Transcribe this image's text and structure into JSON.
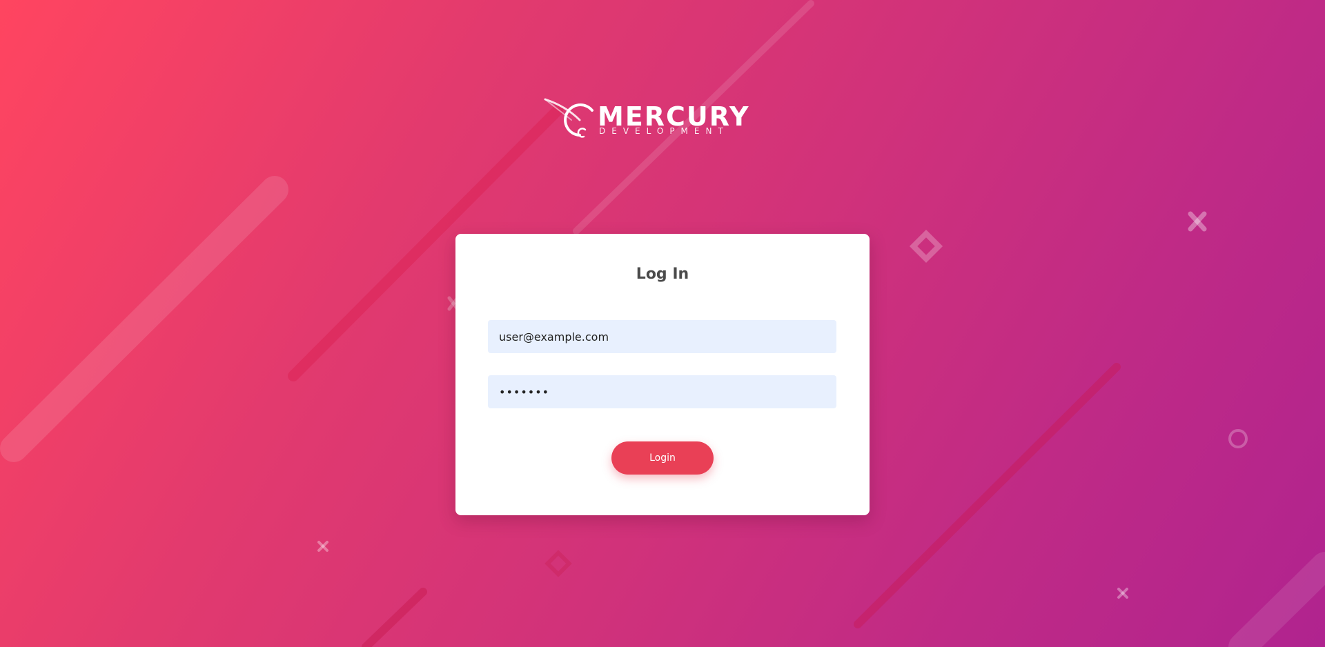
{
  "brand": {
    "name": "MERCURY",
    "tagline": "DEVELOPMENT",
    "logo_icon": "mercury-orbit-icon"
  },
  "login_form": {
    "title": "Log In",
    "email_value": "user@example.com",
    "password_value": "•••••••",
    "submit_label": "Login"
  },
  "colors": {
    "gradient_start": "#ff4560",
    "gradient_end": "#b0238f",
    "button": "#e94056",
    "input_bg": "#e8f0fe",
    "card_bg": "#ffffff"
  }
}
